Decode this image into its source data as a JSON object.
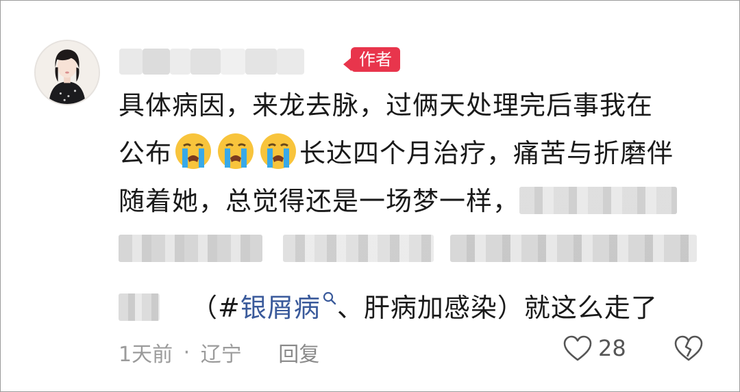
{
  "comment": {
    "author_badge": "作者",
    "lines": [
      {
        "text_a": "具体病因，来龙去脉，过俩天处理完后事我在"
      },
      {
        "text_a": "公布",
        "text_b": "长达四个月治疗，痛苦与折磨伴"
      },
      {
        "text_a": "随着她，总觉得还是一场梦一样，"
      },
      {
        "text_a": ""
      },
      {
        "text_a": "（#",
        "hashtag": "银屑病",
        "text_b": "、肝病加感染）就这么走了"
      }
    ],
    "emoji_name": "loudly-crying-face"
  },
  "footer": {
    "time": "1天前",
    "separator": "·",
    "location": "辽宁",
    "reply_label": "回复",
    "like_count": "28"
  },
  "colors": {
    "badge": "#e8354c",
    "hashtag": "#3a5a9b",
    "meta": "#9b9b9b"
  },
  "icons": [
    "heart-icon",
    "broken-heart-icon",
    "search-icon"
  ]
}
